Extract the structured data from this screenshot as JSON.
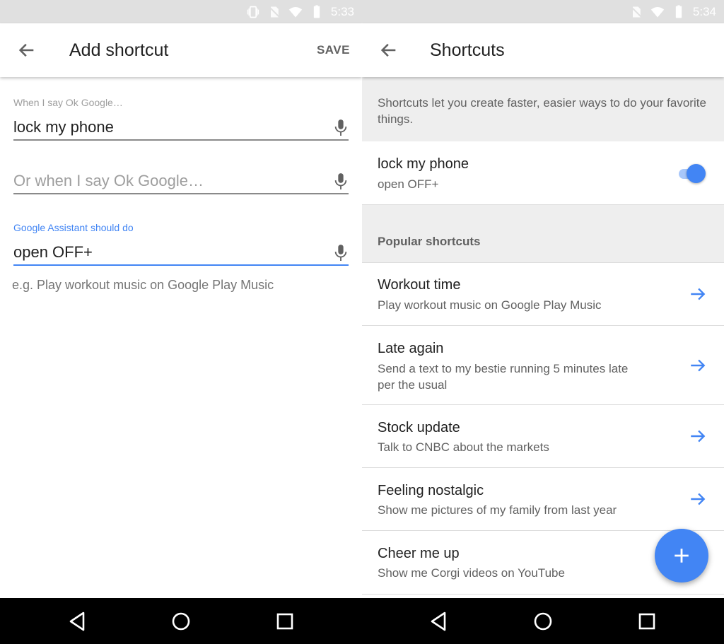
{
  "colors": {
    "accent": "#4285f4",
    "status_bar": "#e0e0e0",
    "nav_bar": "#000000",
    "secondary_bg": "#eeeeee"
  },
  "left_screen": {
    "status_time": "5:33",
    "title": "Add shortcut",
    "save_label": "SAVE",
    "trigger_label": "When I say Ok Google…",
    "trigger_value": "lock my phone",
    "alt_trigger_placeholder": "Or when I say Ok Google…",
    "action_label": "Google Assistant should do",
    "action_value": "open OFF+",
    "action_hint": "e.g. Play workout music on Google Play Music"
  },
  "right_screen": {
    "status_time": "5:34",
    "title": "Shortcuts",
    "intro": "Shortcuts let you create faster, easier ways to do your favorite things.",
    "my_shortcut": {
      "title": "lock my phone",
      "subtitle": "open OFF+",
      "enabled": true
    },
    "popular_heading": "Popular shortcuts",
    "popular": [
      {
        "title": "Workout time",
        "subtitle": "Play workout music on Google Play Music"
      },
      {
        "title": "Late again",
        "subtitle": "Send a text to my bestie running 5 minutes late per the usual"
      },
      {
        "title": "Stock update",
        "subtitle": "Talk to CNBC about the markets"
      },
      {
        "title": "Feeling nostalgic",
        "subtitle": "Show me pictures of my family from last year"
      },
      {
        "title": "Cheer me up",
        "subtitle": "Show me Corgi videos on YouTube"
      }
    ]
  },
  "icons": {
    "back": "arrow-left-icon",
    "mic": "microphone-icon",
    "go": "arrow-right-icon",
    "add": "plus-icon",
    "nav_back": "triangle-back-icon",
    "nav_home": "circle-home-icon",
    "nav_recents": "square-recents-icon"
  }
}
